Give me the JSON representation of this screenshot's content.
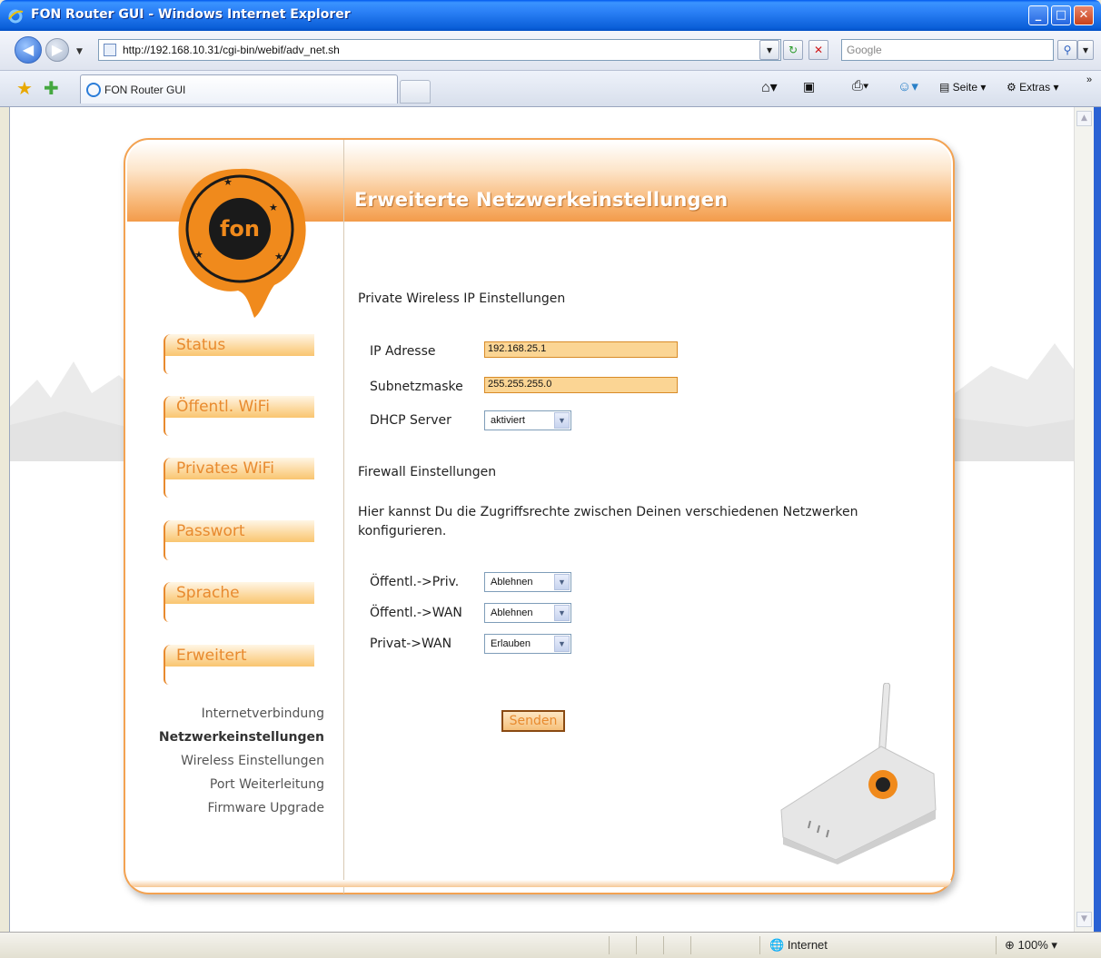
{
  "window": {
    "title": "FON Router GUI - Windows Internet Explorer",
    "minimize": "_",
    "maximize": "□",
    "close": "✕"
  },
  "addressbar": {
    "url": "http://192.168.10.31/cgi-bin/webif/adv_net.sh",
    "search_placeholder": "Google"
  },
  "tabs": [
    {
      "label": "FON Router GUI"
    }
  ],
  "toolbar": {
    "page_label": "Seite",
    "extras_label": "Extras"
  },
  "statusbar": {
    "zone": "Internet",
    "zoom": "100%"
  },
  "page": {
    "title": "Erweiterte Netzwerkeinstellungen",
    "menu": [
      {
        "label": "Status"
      },
      {
        "label": "Öffentl. WiFi"
      },
      {
        "label": "Privates WiFi"
      },
      {
        "label": "Passwort"
      },
      {
        "label": "Sprache"
      },
      {
        "label": "Erweitert"
      }
    ],
    "submenu": [
      {
        "label": "Internetverbindung",
        "active": false
      },
      {
        "label": "Netzwerkeinstellungen",
        "active": true
      },
      {
        "label": "Wireless Einstellungen",
        "active": false
      },
      {
        "label": "Port Weiterleitung",
        "active": false
      },
      {
        "label": "Firmware Upgrade",
        "active": false
      }
    ],
    "private_wireless": {
      "heading": "Private Wireless IP Einstellungen",
      "ip_label": "IP Adresse",
      "ip_value": "192.168.25.1",
      "subnet_label": "Subnetzmaske",
      "subnet_value": "255.255.255.0",
      "dhcp_label": "DHCP Server",
      "dhcp_value": "aktiviert"
    },
    "firewall": {
      "heading": "Firewall Einstellungen",
      "description_line1": "Hier kannst Du die Zugriffsrechte zwischen Deinen verschiedenen Netzwerken",
      "description_line2": "konfigurieren.",
      "rules": [
        {
          "label": "Öffentl.->Priv.",
          "value": "Ablehnen"
        },
        {
          "label": "Öffentl.->WAN",
          "value": "Ablehnen"
        },
        {
          "label": "Privat->WAN",
          "value": "Erlauben"
        }
      ]
    },
    "submit_label": "Senden",
    "logo_text": "fon",
    "colors": {
      "accent": "#f39b4a",
      "menu_text": "#e88a2e",
      "input_bg": "#fbd594"
    }
  }
}
